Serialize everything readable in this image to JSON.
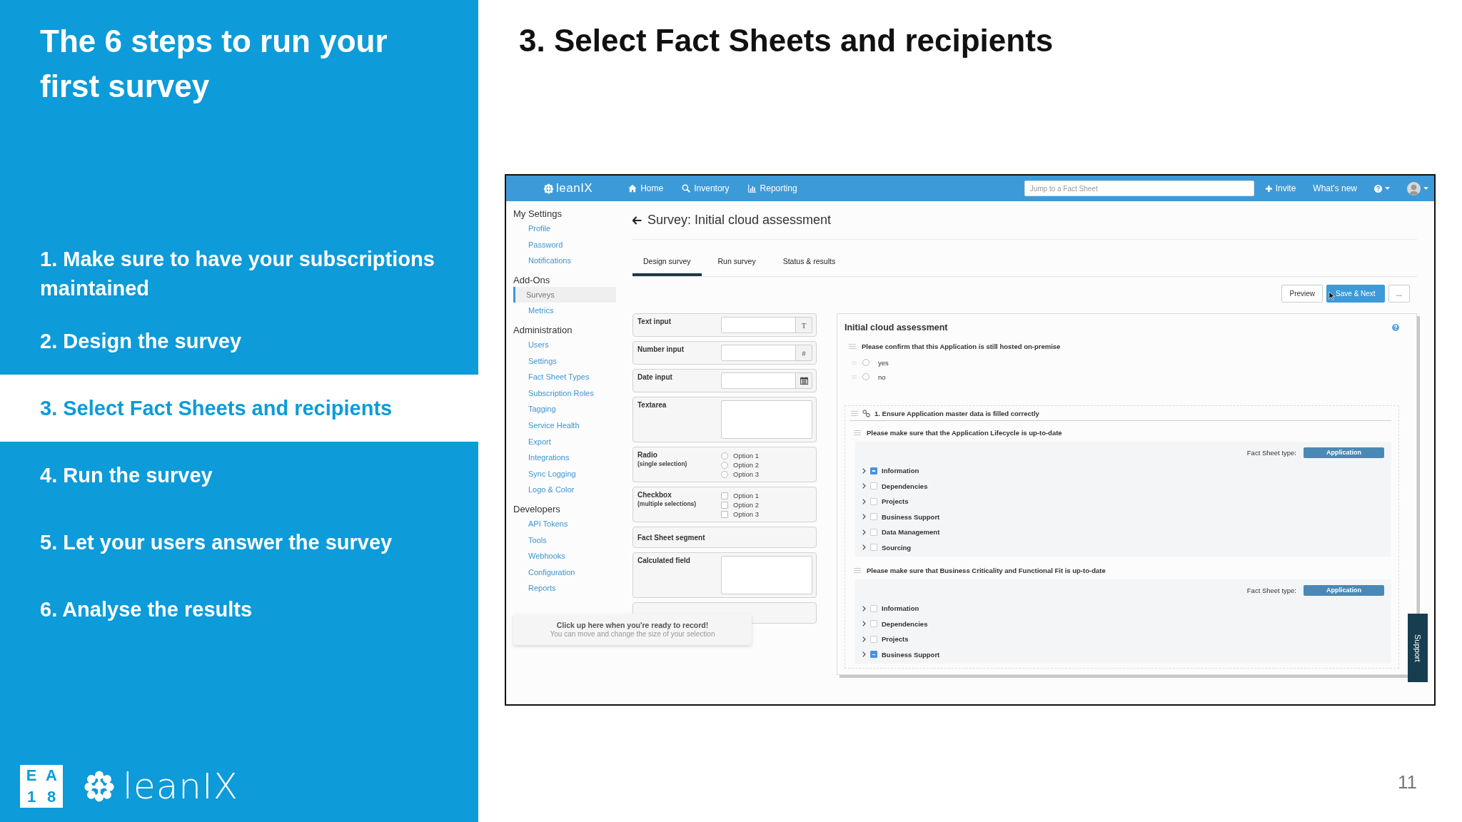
{
  "slide": {
    "title": "The 6 steps to run your first survey",
    "steps": [
      {
        "label": "1. Make sure to have your subscriptions maintained",
        "selected": false
      },
      {
        "label": "2. Design the survey",
        "selected": false
      },
      {
        "label": "3. Select Fact Sheets and recipients",
        "selected": true
      },
      {
        "label": "4. Run the survey",
        "selected": false
      },
      {
        "label": "5. Let your users answer the survey",
        "selected": false
      },
      {
        "label": "6. Analyse the results",
        "selected": false
      }
    ],
    "event_logo": [
      "E",
      "A",
      "1",
      "8"
    ],
    "brand": "leanIX"
  },
  "heading": "3. Select Fact Sheets and recipients",
  "page_number": "11",
  "app": {
    "navbar": {
      "brand": "leanIX",
      "links": [
        {
          "kind": "home",
          "label": "Home"
        },
        {
          "kind": "search",
          "label": "Inventory"
        },
        {
          "kind": "chart",
          "label": "Reporting"
        }
      ],
      "search": {
        "placeholder": "Jump to a Fact Sheet"
      },
      "invite": "Invite",
      "whats_new": "What's new"
    },
    "sidebar": [
      {
        "title": "My Settings",
        "items": [
          {
            "label": "Profile",
            "selected": false
          },
          {
            "label": "Password",
            "selected": false
          },
          {
            "label": "Notifications",
            "selected": false
          }
        ]
      },
      {
        "title": "Add-Ons",
        "items": [
          {
            "label": "Surveys",
            "selected": true
          },
          {
            "label": "Metrics",
            "selected": false
          }
        ]
      },
      {
        "title": "Administration",
        "items": [
          {
            "label": "Users",
            "selected": false
          },
          {
            "label": "Settings",
            "selected": false
          },
          {
            "label": "Fact Sheet Types",
            "selected": false
          },
          {
            "label": "Subscription Roles",
            "selected": false
          },
          {
            "label": "Tagging",
            "selected": false
          },
          {
            "label": "Service Health",
            "selected": false
          },
          {
            "label": "Export",
            "selected": false
          },
          {
            "label": "Integrations",
            "selected": false
          },
          {
            "label": "Sync Logging",
            "selected": false
          },
          {
            "label": "Logo & Color",
            "selected": false
          }
        ]
      },
      {
        "title": "Developers",
        "items": [
          {
            "label": "API Tokens",
            "selected": false
          },
          {
            "label": "Tools",
            "selected": false
          },
          {
            "label": "Webhooks",
            "selected": false
          },
          {
            "label": "Configuration",
            "selected": false
          },
          {
            "label": "Reports",
            "selected": false
          }
        ]
      }
    ],
    "page_title": "Survey: Initial cloud assessment",
    "tabs": [
      {
        "label": "Design survey",
        "selected": true
      },
      {
        "label": "Run survey",
        "selected": false
      },
      {
        "label": "Status & results",
        "selected": false
      }
    ],
    "buttons": [
      {
        "label": "Preview",
        "kind": "default"
      },
      {
        "label": "Save & Next",
        "kind": "primary"
      },
      {
        "label": "...",
        "kind": "default"
      }
    ],
    "palette": [
      {
        "kind": "input",
        "label": "Text input",
        "addon": "T"
      },
      {
        "kind": "input",
        "label": "Number input",
        "addon": "#"
      },
      {
        "kind": "date",
        "label": "Date input"
      },
      {
        "kind": "textarea",
        "label": "Textarea"
      },
      {
        "kind": "radio",
        "label": "Radio",
        "note": "(single selection)",
        "options": [
          {
            "label": "Option 1",
            "checked": false
          },
          {
            "label": "Option 2",
            "checked": false
          },
          {
            "label": "Option 3",
            "checked": false
          }
        ]
      },
      {
        "kind": "checkbox",
        "label": "Checkbox",
        "note": "(multiple selections)",
        "options": [
          {
            "label": "Option 1",
            "checked": false
          },
          {
            "label": "Option 2",
            "checked": false
          },
          {
            "label": "Option 3",
            "checked": false
          }
        ]
      },
      {
        "kind": "segment",
        "label": "Fact Sheet segment"
      },
      {
        "kind": "textarea",
        "label": "Calculated field"
      },
      {
        "kind": "group"
      }
    ],
    "toast": {
      "title": "Click up here when you're ready to record!",
      "text": "You can move and change the size of your selection"
    },
    "survey": {
      "title": "Initial cloud assessment",
      "questions": [
        {
          "kind": "choice",
          "text": "Please confirm that this Application is still hosted on-premise",
          "options": [
            {
              "label": "yes",
              "selected": false
            },
            {
              "label": "no",
              "selected": false
            }
          ]
        },
        {
          "kind": "group",
          "title": "1. Ensure Application master data is filled correctly",
          "questions": [
            {
              "kind": "tree",
              "text": "Please make sure that the Application Lifecycle is up-to-date",
              "type_label": "Fact Sheet type:",
              "type": "Application",
              "items": [
                {
                  "label": "Information",
                  "checked": true
                },
                {
                  "label": "Dependencies",
                  "checked": false
                },
                {
                  "label": "Projects",
                  "checked": false
                },
                {
                  "label": "Business Support",
                  "checked": false
                },
                {
                  "label": "Data Management",
                  "checked": false
                },
                {
                  "label": "Sourcing",
                  "checked": false
                }
              ]
            },
            {
              "kind": "tree",
              "text": "Please make sure that Business Criticality and Functional Fit is up-to-date",
              "type_label": "Fact Sheet type:",
              "type": "Application",
              "items": [
                {
                  "label": "Information",
                  "checked": false
                },
                {
                  "label": "Dependencies",
                  "checked": false
                },
                {
                  "label": "Projects",
                  "checked": false
                },
                {
                  "label": "Business Support",
                  "checked": true
                }
              ]
            }
          ]
        }
      ]
    },
    "support": "Support"
  }
}
